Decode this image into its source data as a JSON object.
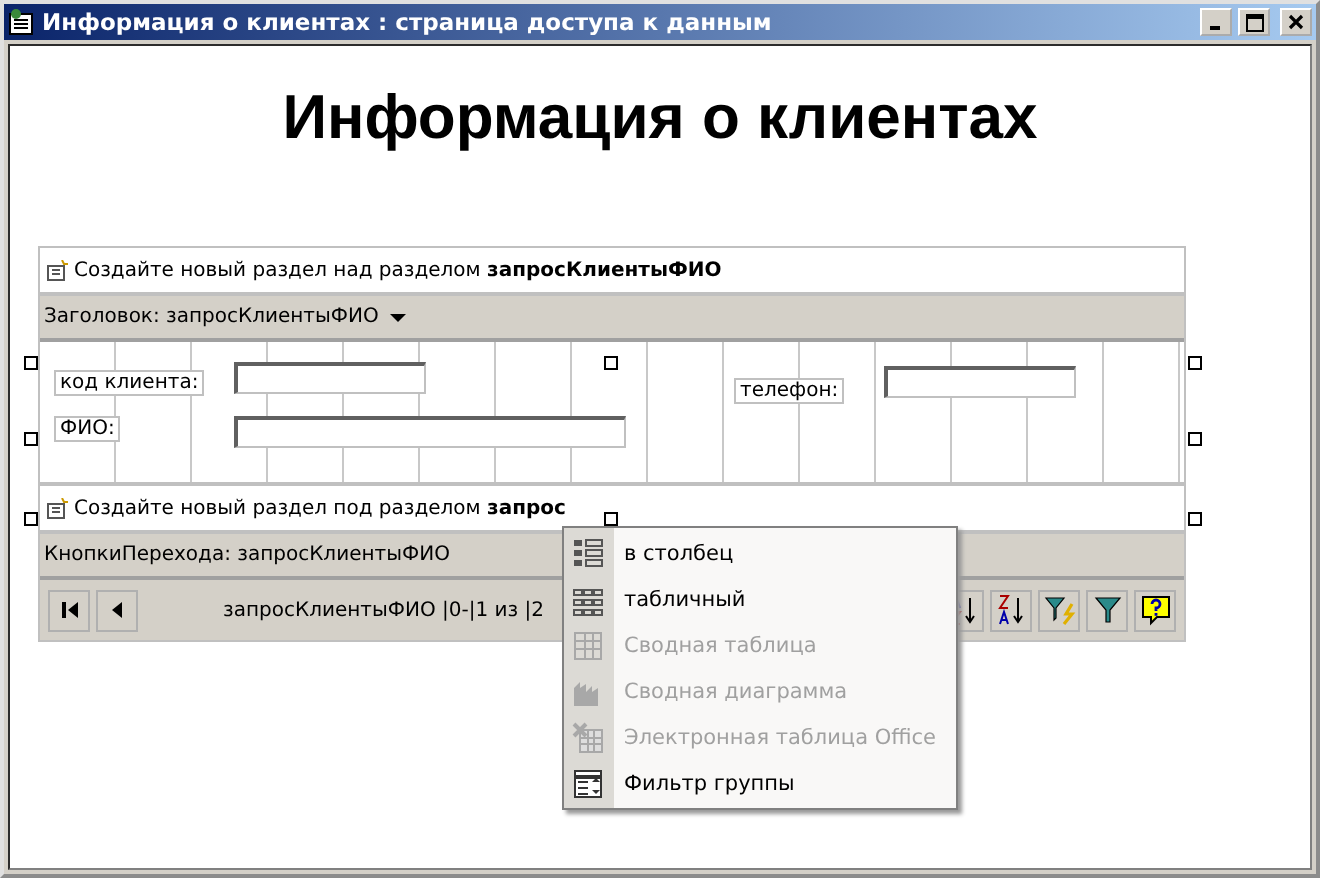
{
  "window": {
    "title": "Информация о клиентах : страница доступа к данным"
  },
  "heading": "Информация о клиентах",
  "section": {
    "create_above": "Создайте новый раздел над разделом **запросКлиентыФИО**",
    "header_band": "Заголовок: запросКлиентыФИО",
    "fields": [
      {
        "label": "код клиента:"
      },
      {
        "label": "ФИО:"
      },
      {
        "label": "телефон:"
      }
    ],
    "create_below": "Создайте новый раздел под разделом **запрос**",
    "nav_band": "КнопкиПерехода: запросКлиентыФИО",
    "nav_status": "запросКлиентыФИО |0-|1 из |2"
  },
  "menu": [
    {
      "label": "в столбец",
      "disabled": false
    },
    {
      "label": "табличный",
      "disabled": false
    },
    {
      "label": "Сводная таблица",
      "disabled": true
    },
    {
      "label": "Сводная диаграмма",
      "disabled": true
    },
    {
      "label": "Электронная таблица Office",
      "disabled": true
    },
    {
      "label": "Фильтр группы",
      "disabled": false
    }
  ]
}
